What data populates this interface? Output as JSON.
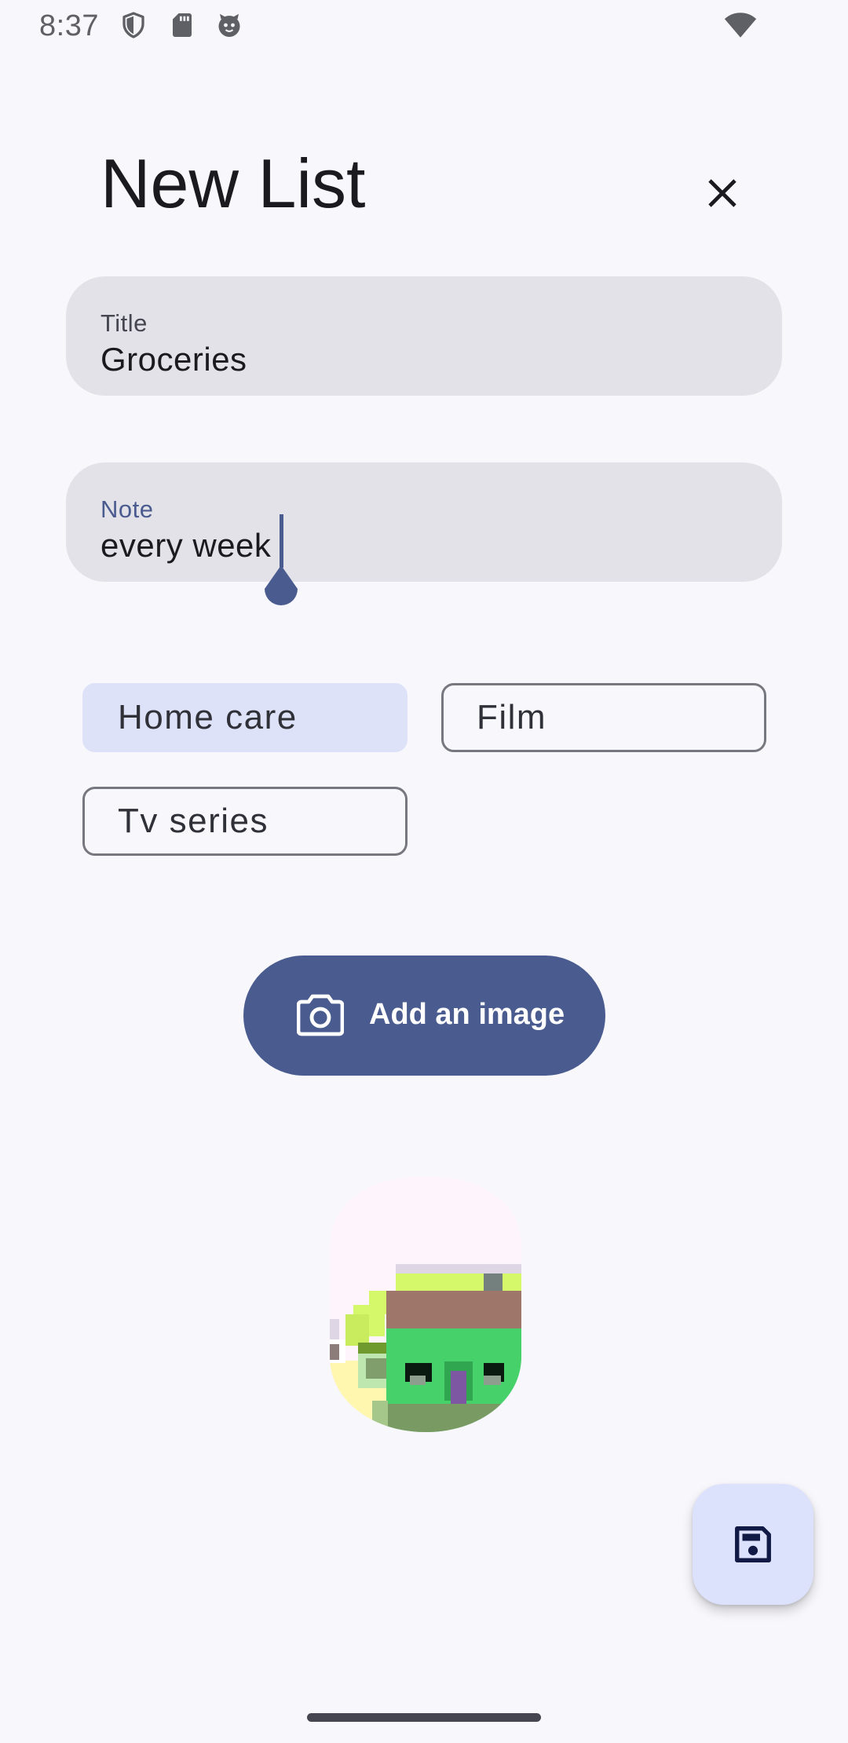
{
  "status_bar": {
    "time": "8:37",
    "icons": [
      "shield-icon",
      "sd-card-icon",
      "assistant-face-icon",
      "wifi-icon"
    ]
  },
  "dialog": {
    "title": "New List",
    "close_icon": "close-icon"
  },
  "form": {
    "title_field": {
      "label": "Title",
      "value": "Groceries"
    },
    "note_field": {
      "label": "Note",
      "value": "every week"
    }
  },
  "categories": [
    {
      "label": "Home care",
      "selected": true
    },
    {
      "label": "Film",
      "selected": false
    },
    {
      "label": "Tv series",
      "selected": false
    }
  ],
  "add_image_button": {
    "label": "Add an image",
    "icon": "camera-icon"
  },
  "save_fab": {
    "icon": "save-icon"
  },
  "colors": {
    "background": "#f8f7fc",
    "primary": "#4a5b8f",
    "field_fill": "#e3e2e8",
    "chip_selected": "#dde2f8",
    "fab": "#dde2fc"
  }
}
